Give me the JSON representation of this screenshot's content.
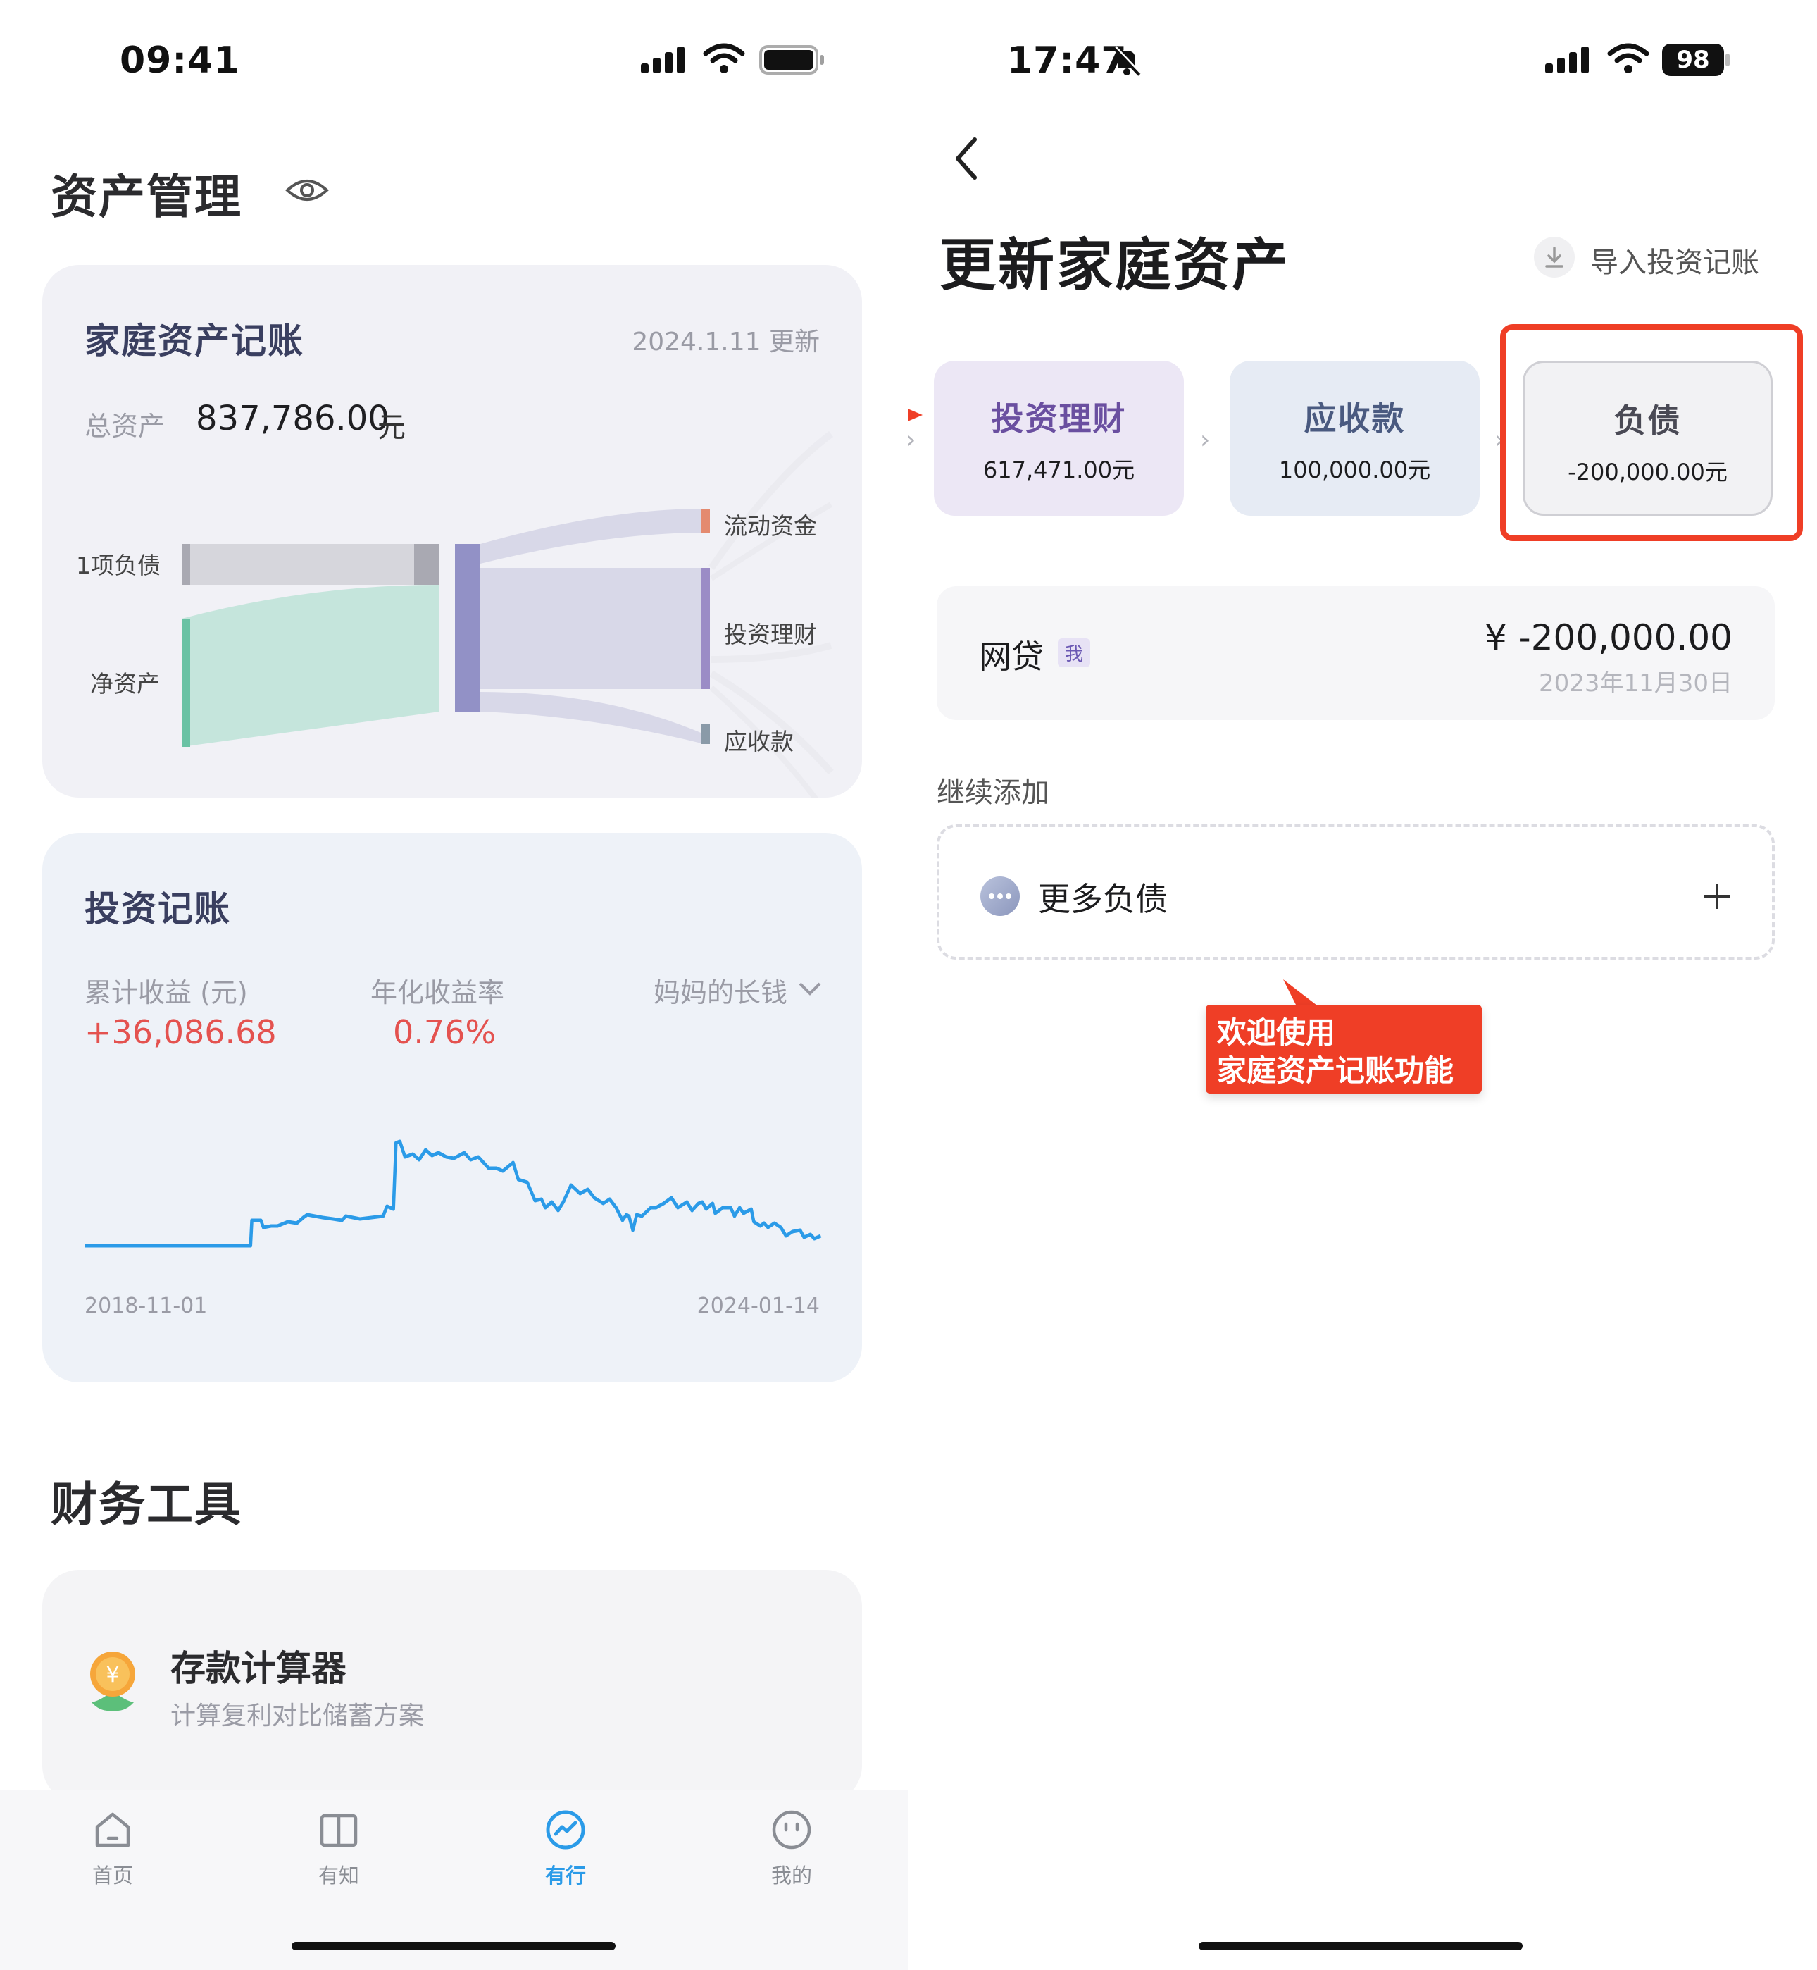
{
  "left": {
    "status": {
      "time": "09:41"
    },
    "page_title": "资产管理",
    "family_card": {
      "title": "家庭资产记账",
      "updated": "2024.1.11 更新",
      "total_label": "总资产",
      "total_value": "837,786.00",
      "total_unit": "元",
      "left_nodes": [
        "1项负债",
        "净资产"
      ],
      "right_nodes": [
        "流动资金",
        "投资理财",
        "应收款"
      ]
    },
    "invest_card": {
      "title": "投资记账",
      "cum_label": "累计收益 (元)",
      "cum_value": "+36,086.68",
      "rate_label": "年化收益率",
      "rate_value": "0.76%",
      "account": "妈妈的长钱",
      "start_date": "2018-11-01",
      "end_date": "2024-01-14",
      "line_color": "#2b9be8"
    },
    "tools_title": "财务工具",
    "tool": {
      "name": "存款计算器",
      "desc": "计算复利对比储蓄方案"
    },
    "tabbar": [
      {
        "label": "首页",
        "icon": "home-icon"
      },
      {
        "label": "有知",
        "icon": "book-icon"
      },
      {
        "label": "有行",
        "icon": "trend-icon"
      },
      {
        "label": "我的",
        "icon": "smile-icon"
      }
    ],
    "active_tab_color": "#2b9be8"
  },
  "right": {
    "status": {
      "time": "17:47",
      "battery": "98"
    },
    "page_title": "更新家庭资产",
    "import_label": "导入投资记账",
    "categories": [
      {
        "name": "投资理财",
        "value": "617,471.00元"
      },
      {
        "name": "应收款",
        "value": "100,000.00元"
      },
      {
        "name": "负债",
        "value": "-200,000.00元"
      }
    ],
    "debt_item": {
      "name": "网贷",
      "tag": "我",
      "amount": "¥ -200,000.00",
      "date": "2023年11月30日"
    },
    "continue_label": "继续添加",
    "more_label": "更多负债",
    "callout": {
      "line1": "欢迎使用",
      "line2": "家庭资产记账功能"
    },
    "accent_red": "#ef3e26"
  }
}
